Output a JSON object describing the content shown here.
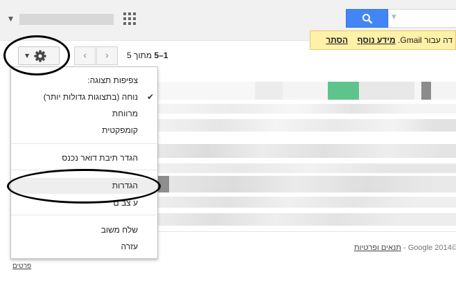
{
  "notice": {
    "text": "דה עבור Gmail.",
    "more_info_link": "מידע נוסף",
    "hide_link": "הסתר"
  },
  "toolbar": {
    "pager_range": "1–5",
    "pager_of": "מתוך",
    "pager_total": "5",
    "prev_glyph": "‹",
    "next_glyph": "›"
  },
  "settings_menu": {
    "header": "צפיפות תצוגה:",
    "density_options": [
      {
        "label": "נוחה (בתצוגות גדולות יותר)",
        "checked": true
      },
      {
        "label": "מרווחת",
        "checked": false
      },
      {
        "label": "קומפקטית",
        "checked": false
      }
    ],
    "configure_inbox": "הגדר תיבת דואר נכנס",
    "settings": "הגדרות",
    "themes_partial": "ע צב ם",
    "send_feedback": "שלח משוב",
    "help": "עזרה"
  },
  "footer": {
    "copyright": "©2014 Google -",
    "terms_link": "תנאים ופרטיות",
    "details_link": "פרטים"
  },
  "icons": {
    "search": "search-icon",
    "apps": "apps-grid-icon",
    "gear": "gear-icon",
    "checkmark": "checkmark-icon"
  },
  "colors": {
    "search_blue": "#4285f4",
    "notice_yellow": "#fff1a8",
    "menu_highlight": "#eeeeee"
  }
}
